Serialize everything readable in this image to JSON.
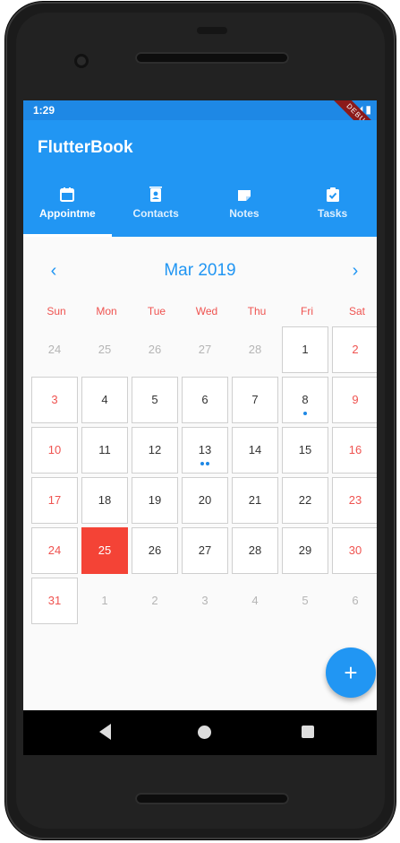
{
  "status": {
    "time": "1:29",
    "debug": "DEBUG"
  },
  "app": {
    "title": "FlutterBook"
  },
  "tabs": [
    {
      "label": "Appointme",
      "icon": "calendar-icon",
      "active": true
    },
    {
      "label": "Contacts",
      "icon": "contacts-icon",
      "active": false
    },
    {
      "label": "Notes",
      "icon": "note-icon",
      "active": false
    },
    {
      "label": "Tasks",
      "icon": "task-check-icon",
      "active": false
    }
  ],
  "calendar": {
    "month_title": "Mar 2019",
    "prev": "‹",
    "next": "›",
    "weekdays": [
      "Sun",
      "Mon",
      "Tue",
      "Wed",
      "Thu",
      "Fri",
      "Sat"
    ],
    "weeks": [
      [
        "24",
        "25",
        "26",
        "27",
        "28",
        "1",
        "2"
      ],
      [
        "3",
        "4",
        "5",
        "6",
        "7",
        "8",
        "9"
      ],
      [
        "10",
        "11",
        "12",
        "13",
        "14",
        "15",
        "16"
      ],
      [
        "17",
        "18",
        "19",
        "20",
        "21",
        "22",
        "23"
      ],
      [
        "24",
        "25",
        "26",
        "27",
        "28",
        "29",
        "30"
      ],
      [
        "31",
        "1",
        "2",
        "3",
        "4",
        "5",
        "6"
      ]
    ],
    "today": "25",
    "event_dots": {
      "8": 1,
      "13": 2
    }
  },
  "fab": {
    "label": "+"
  },
  "colors": {
    "primary": "#2196f3",
    "status_bar": "#1e88e5",
    "today": "#f44336",
    "weekend": "#ef5350"
  }
}
